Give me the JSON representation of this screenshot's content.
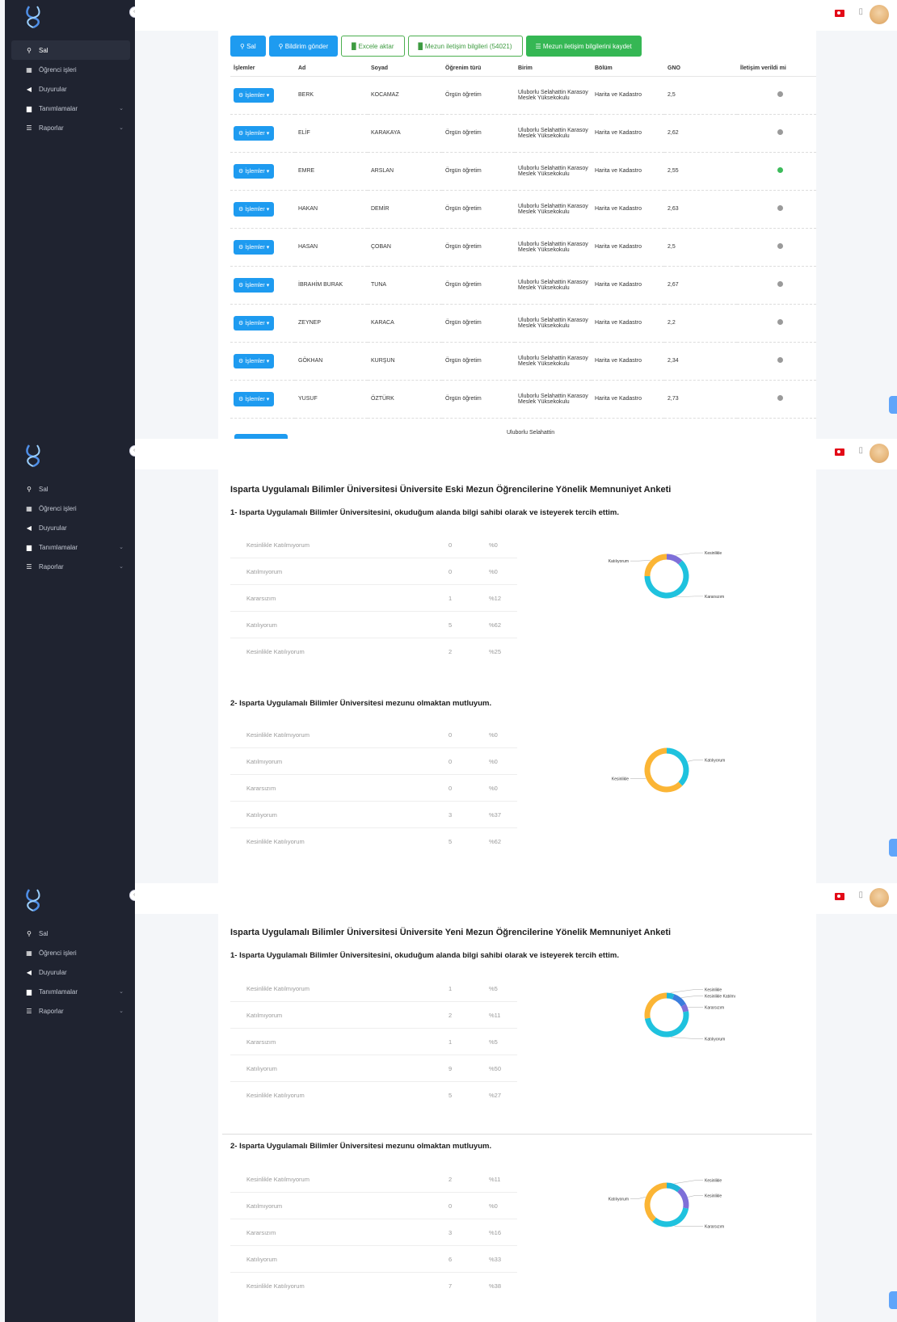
{
  "sidebar": {
    "items": [
      {
        "label": "Sal",
        "icon": "search-icon",
        "has_chevron": false
      },
      {
        "label": "Öğrenci işleri",
        "icon": "grid-icon",
        "has_chevron": false
      },
      {
        "label": "Duyurular",
        "icon": "megaphone-icon",
        "has_chevron": false
      },
      {
        "label": "Tanımlamalar",
        "icon": "building-icon",
        "has_chevron": true
      },
      {
        "label": "Raporlar",
        "icon": "report-icon",
        "has_chevron": true
      }
    ]
  },
  "toolbar": {
    "buttons": [
      {
        "label": "Sal"
      },
      {
        "label": "Bildirim gönder"
      },
      {
        "label": "Excele aktar"
      },
      {
        "label": "Mezun iletişim bilgileri (54021)"
      },
      {
        "label": "Mezun iletişim bilgilerini kaydet"
      }
    ]
  },
  "students_table": {
    "headers": [
      "İşlemler",
      "Ad",
      "Soyad",
      "Öğrenim türü",
      "Birim",
      "Bölüm",
      "GNO",
      "İletişim verildi mi"
    ],
    "op_label": "İşlemler",
    "rows": [
      {
        "ad": "BERK",
        "soyad": "KOCAMAZ",
        "tur": "Örgün öğretim",
        "birim": "Uluborlu Selahattin Karasoy Meslek Yüksekokulu",
        "bolum": "Harita ve Kadastro",
        "gno": "2,5",
        "iletisim": false
      },
      {
        "ad": "ELİF",
        "soyad": "KARAKAYA",
        "tur": "Örgün öğretim",
        "birim": "Uluborlu Selahattin Karasoy Meslek Yüksekokulu",
        "bolum": "Harita ve Kadastro",
        "gno": "2,62",
        "iletisim": false
      },
      {
        "ad": "EMRE",
        "soyad": "ARSLAN",
        "tur": "Örgün öğretim",
        "birim": "Uluborlu Selahattin Karasoy Meslek Yüksekokulu",
        "bolum": "Harita ve Kadastro",
        "gno": "2,55",
        "iletisim": true
      },
      {
        "ad": "HAKAN",
        "soyad": "DEMİR",
        "tur": "Örgün öğretim",
        "birim": "Uluborlu Selahattin Karasoy Meslek Yüksekokulu",
        "bolum": "Harita ve Kadastro",
        "gno": "2,63",
        "iletisim": false
      },
      {
        "ad": "HASAN",
        "soyad": "ÇOBAN",
        "tur": "Örgün öğretim",
        "birim": "Uluborlu Selahattin Karasoy Meslek Yüksekokulu",
        "bolum": "Harita ve Kadastro",
        "gno": "2,5",
        "iletisim": false
      },
      {
        "ad": "İBRAHİM BURAK",
        "soyad": "TUNA",
        "tur": "Örgün öğretim",
        "birim": "Uluborlu Selahattin Karasoy Meslek Yüksekokulu",
        "bolum": "Harita ve Kadastro",
        "gno": "2,67",
        "iletisim": false
      },
      {
        "ad": "ZEYNEP",
        "soyad": "KARACA",
        "tur": "Örgün öğretim",
        "birim": "Uluborlu Selahattin Karasoy Meslek Yüksekokulu",
        "bolum": "Harita ve Kadastro",
        "gno": "2,2",
        "iletisim": false
      },
      {
        "ad": "GÖKHAN",
        "soyad": "KURŞUN",
        "tur": "Örgün öğretim",
        "birim": "Uluborlu Selahattin Karasoy Meslek Yüksekokulu",
        "bolum": "Harita ve Kadastro",
        "gno": "2,34",
        "iletisim": false
      },
      {
        "ad": "YUSUF",
        "soyad": "ÖZTÜRK",
        "tur": "Örgün öğretim",
        "birim": "Uluborlu Selahattin Karasoy Meslek Yüksekokulu",
        "bolum": "Harita ve Kadastro",
        "gno": "2,73",
        "iletisim": false
      }
    ],
    "partial_row_birim": "Uluborlu Selahattin"
  },
  "survey_old": {
    "title": "Isparta Uygulamalı Bilimler Üniversitesi Üniversite Eski Mezun Öğrencilerine Yönelik Memnuniyet Anketi",
    "questions": [
      {
        "title": "1- Isparta Uygulamalı Bilimler Üniversitesini, okuduğum alanda bilgi sahibi olarak ve isteyerek tercih ettim.",
        "options": [
          {
            "label": "Kesinlikle Katılmıyorum",
            "count": "0",
            "percent": "%0"
          },
          {
            "label": "Katılmıyorum",
            "count": "0",
            "percent": "%0"
          },
          {
            "label": "Kararsızım",
            "count": "1",
            "percent": "%12"
          },
          {
            "label": "Katılıyorum",
            "count": "5",
            "percent": "%62"
          },
          {
            "label": "Kesinlikle Katılıyorum",
            "count": "2",
            "percent": "%25"
          }
        ],
        "chart_labels": [
          "Kesinlikle",
          "Kararsızım",
          "Katılıyorum"
        ]
      },
      {
        "title": "2- Isparta Uygulamalı Bilimler Üniversitesi mezunu olmaktan mutluyum.",
        "options": [
          {
            "label": "Kesinlikle Katılmıyorum",
            "count": "0",
            "percent": "%0"
          },
          {
            "label": "Katılmıyorum",
            "count": "0",
            "percent": "%0"
          },
          {
            "label": "Kararsızım",
            "count": "0",
            "percent": "%0"
          },
          {
            "label": "Katılıyorum",
            "count": "3",
            "percent": "%37"
          },
          {
            "label": "Kesinlikle Katılıyorum",
            "count": "5",
            "percent": "%62"
          }
        ],
        "chart_labels": [
          "Katılıyorum",
          "Kesinlikle"
        ]
      }
    ]
  },
  "survey_new": {
    "title": "Isparta Uygulamalı Bilimler Üniversitesi Üniversite Yeni Mezun Öğrencilerine Yönelik Memnuniyet Anketi",
    "questions": [
      {
        "title": "1- Isparta Uygulamalı Bilimler Üniversitesini, okuduğum alanda bilgi sahibi olarak ve isteyerek tercih ettim.",
        "options": [
          {
            "label": "Kesinlikle Katılmıyorum",
            "count": "1",
            "percent": "%5"
          },
          {
            "label": "Katılmıyorum",
            "count": "2",
            "percent": "%11"
          },
          {
            "label": "Kararsızım",
            "count": "1",
            "percent": "%5"
          },
          {
            "label": "Katılıyorum",
            "count": "9",
            "percent": "%50"
          },
          {
            "label": "Kesinlikle Katılıyorum",
            "count": "5",
            "percent": "%27"
          }
        ],
        "chart_labels": [
          "Kesinlikle",
          "Kesinlikle Katılmıyorum",
          "Kararsızım",
          "Katılıyorum"
        ]
      },
      {
        "title": "2- Isparta Uygulamalı Bilimler Üniversitesi mezunu olmaktan mutluyum.",
        "options": [
          {
            "label": "Kesinlikle Katılmıyorum",
            "count": "2",
            "percent": "%11"
          },
          {
            "label": "Katılmıyorum",
            "count": "0",
            "percent": "%0"
          },
          {
            "label": "Kararsızım",
            "count": "3",
            "percent": "%16"
          },
          {
            "label": "Katılıyorum",
            "count": "6",
            "percent": "%33"
          },
          {
            "label": "Kesinlikle Katılıyorum",
            "count": "7",
            "percent": "%38"
          }
        ],
        "chart_labels": [
          "Kesinlikle",
          "Kesinlikle",
          "Kararsızım",
          "Katılıyorum"
        ]
      }
    ]
  },
  "chart_data": [
    {
      "type": "pie",
      "categories": [
        "Kesinlikle Katılmıyorum",
        "Katılmıyorum",
        "Kararsızım",
        "Katılıyorum",
        "Kesinlikle Katılıyorum"
      ],
      "values": [
        0,
        0,
        1,
        5,
        2
      ],
      "colors": [
        "#1fb6d9",
        "#e74c3c",
        "#7e6fd8",
        "#1fc2de",
        "#fbb535"
      ]
    },
    {
      "type": "pie",
      "categories": [
        "Kesinlikle Katılmıyorum",
        "Katılmıyorum",
        "Kararsızım",
        "Katılıyorum",
        "Kesinlikle Katılıyorum"
      ],
      "values": [
        0,
        0,
        0,
        3,
        5
      ],
      "colors": [
        "#1fb6d9",
        "#e74c3c",
        "#7e6fd8",
        "#1fc2de",
        "#fbb535"
      ]
    },
    {
      "type": "pie",
      "categories": [
        "Kesinlikle Katılmıyorum",
        "Katılmıyorum",
        "Kararsızım",
        "Katılıyorum",
        "Kesinlikle Katılıyorum"
      ],
      "values": [
        1,
        2,
        1,
        9,
        5
      ],
      "colors": [
        "#1fb6d9",
        "#3b7ddd",
        "#7e6fd8",
        "#1fc2de",
        "#fbb535"
      ]
    },
    {
      "type": "pie",
      "categories": [
        "Kesinlikle Katılmıyorum",
        "Katılmıyorum",
        "Kararsızım",
        "Katılıyorum",
        "Kesinlikle Katılıyorum"
      ],
      "values": [
        2,
        0,
        3,
        6,
        7
      ],
      "colors": [
        "#1fb6d9",
        "#3b7ddd",
        "#7e6fd8",
        "#1fc2de",
        "#fbb535"
      ]
    }
  ]
}
